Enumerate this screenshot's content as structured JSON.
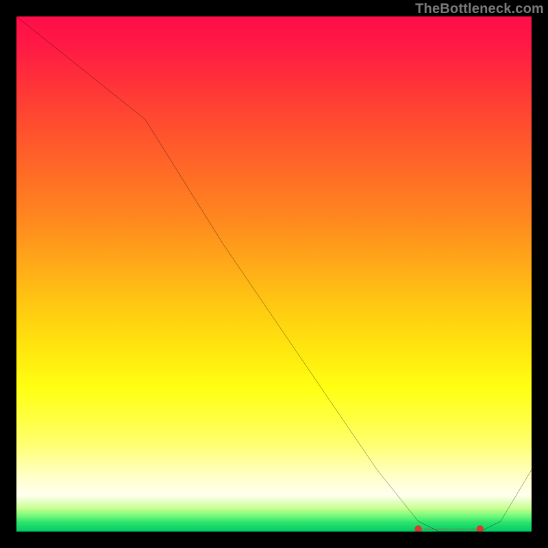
{
  "watermark": "TheBottleneck.com",
  "chart_data": {
    "type": "line",
    "title": "",
    "xlabel": "",
    "ylabel": "",
    "xlim": [
      0,
      100
    ],
    "ylim": [
      0,
      100
    ],
    "x": [
      0,
      10,
      25,
      40,
      55,
      70,
      78,
      82,
      86,
      90,
      94,
      100
    ],
    "values": [
      100,
      92,
      80,
      56,
      34,
      12,
      2,
      0,
      0,
      0,
      2,
      12
    ],
    "notes": "Single black curve on a vertical red→yellow→green gradient. No axis ticks or series names visible. Curve falls steeply from top-left, flattens near zero around x≈82–90, then rises slightly toward the right edge. A short dashed red segment sits on the baseline under the minimum."
  },
  "marker": {
    "x_start": 78,
    "x_end": 90,
    "y": 0.5,
    "color": "#d33b2f"
  }
}
